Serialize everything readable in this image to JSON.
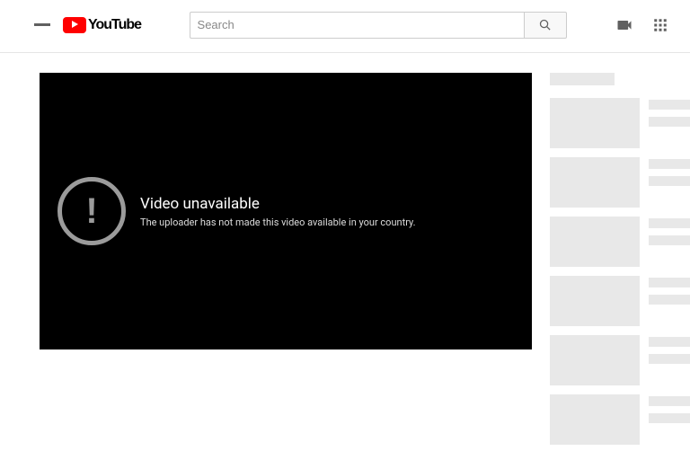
{
  "brand": {
    "name": "YouTube"
  },
  "search": {
    "placeholder": "Search"
  },
  "player_error": {
    "title": "Video unavailable",
    "message": "The uploader has not made this video available in your country."
  },
  "sidebar": {
    "skeleton_rows": 6
  }
}
